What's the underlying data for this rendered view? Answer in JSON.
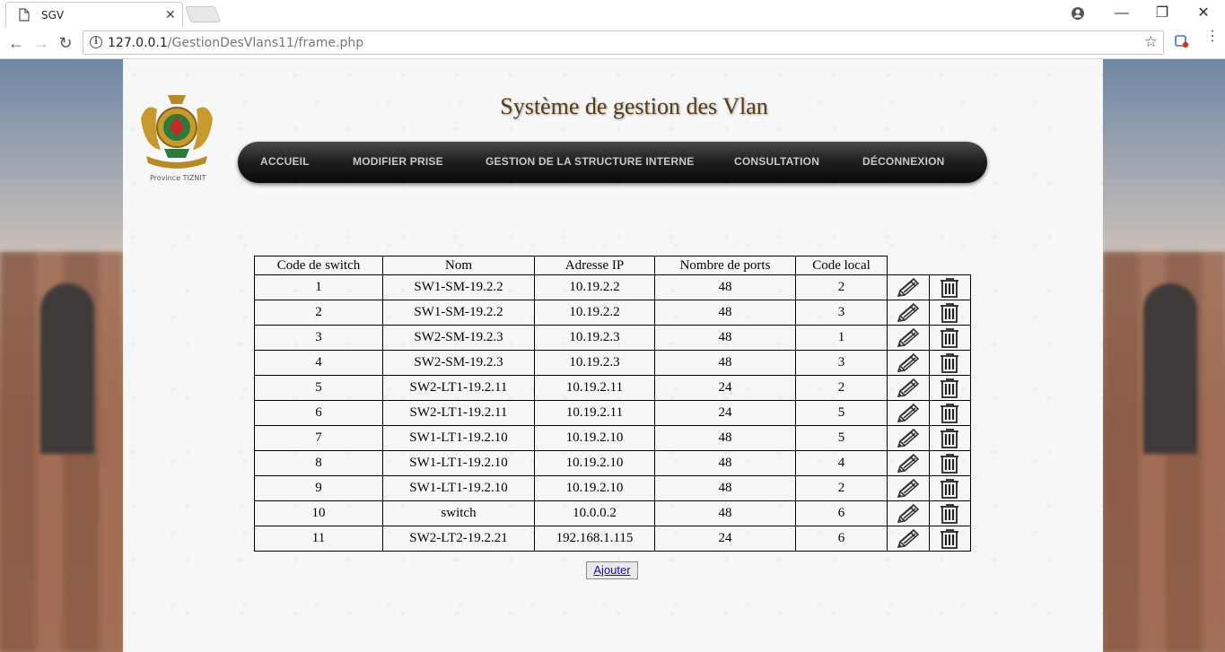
{
  "browser": {
    "tab_title": "SGV",
    "url_host": "127.0.0.1",
    "url_path": "/GestionDesVlans11/frame.php"
  },
  "header": {
    "title": "Système de gestion des Vlan",
    "emblem_caption": "Province TIZNIT"
  },
  "nav": {
    "items": [
      "ACCUEIL",
      "MODIFIER PRISE",
      "GESTION DE LA STRUCTURE INTERNE",
      "CONSULTATION",
      "DÉCONNEXION"
    ]
  },
  "table": {
    "headers": [
      "Code de switch",
      "Nom",
      "Adresse IP",
      "Nombre de ports",
      "Code local"
    ],
    "rows": [
      [
        "1",
        "SW1-SM-19.2.2",
        "10.19.2.2",
        "48",
        "2"
      ],
      [
        "2",
        "SW1-SM-19.2.2",
        "10.19.2.2",
        "48",
        "3"
      ],
      [
        "3",
        "SW2-SM-19.2.3",
        "10.19.2.3",
        "48",
        "1"
      ],
      [
        "4",
        "SW2-SM-19.2.3",
        "10.19.2.3",
        "48",
        "3"
      ],
      [
        "5",
        "SW2-LT1-19.2.11",
        "10.19.2.11",
        "24",
        "2"
      ],
      [
        "6",
        "SW2-LT1-19.2.11",
        "10.19.2.11",
        "24",
        "5"
      ],
      [
        "7",
        "SW1-LT1-19.2.10",
        "10.19.2.10",
        "48",
        "5"
      ],
      [
        "8",
        "SW1-LT1-19.2.10",
        "10.19.2.10",
        "48",
        "4"
      ],
      [
        "9",
        "SW1-LT1-19.2.10",
        "10.19.2.10",
        "48",
        "2"
      ],
      [
        "10",
        "switch",
        "10.0.0.2",
        "48",
        "6"
      ],
      [
        "11",
        "SW2-LT2-19.2.21",
        "192.168.1.115",
        "24",
        "6"
      ]
    ],
    "row_icons": [
      "pencil-icon",
      "trash-icon"
    ]
  },
  "actions": {
    "add_label": "Ajouter"
  }
}
